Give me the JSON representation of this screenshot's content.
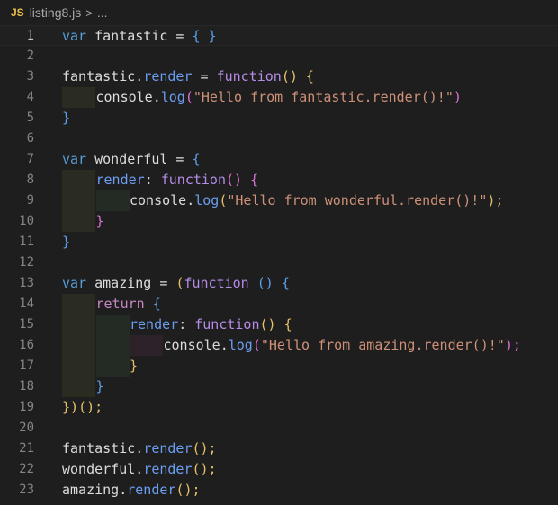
{
  "breadcrumb": {
    "badge": "JS",
    "file": "listing8.js",
    "separator": ">",
    "ellipsis": "..."
  },
  "editor": {
    "current_line": 1,
    "lines": [
      {
        "n": "1",
        "indent": 0,
        "tokens": [
          [
            "var ",
            "tok-var"
          ],
          [
            "fantastic = ",
            "tok-ident"
          ],
          [
            "{ }",
            "tok-brace"
          ]
        ]
      },
      {
        "n": "2",
        "indent": 0,
        "tokens": []
      },
      {
        "n": "3",
        "indent": 0,
        "tokens": [
          [
            "fantastic.",
            "tok-ident"
          ],
          [
            "render",
            "tok-prop"
          ],
          [
            " = ",
            "tok-ident"
          ],
          [
            "function",
            "tok-fn"
          ],
          [
            "() {",
            "tok-paren2"
          ]
        ]
      },
      {
        "n": "4",
        "indent": 1,
        "tokens": [
          [
            "console.",
            "tok-ident"
          ],
          [
            "log",
            "tok-prop"
          ],
          [
            "(",
            "tok-paren"
          ],
          [
            "\"Hello from fantastic.render()!\"",
            "tok-str"
          ],
          [
            ")",
            "tok-paren"
          ]
        ]
      },
      {
        "n": "5",
        "indent": 0,
        "tokens": [
          [
            "}",
            "tok-brace"
          ]
        ]
      },
      {
        "n": "6",
        "indent": 0,
        "tokens": []
      },
      {
        "n": "7",
        "indent": 0,
        "tokens": [
          [
            "var ",
            "tok-var"
          ],
          [
            "wonderful = ",
            "tok-ident"
          ],
          [
            "{",
            "tok-brace"
          ]
        ]
      },
      {
        "n": "8",
        "indent": 1,
        "tokens": [
          [
            "render",
            "tok-prop"
          ],
          [
            ": ",
            "tok-ident"
          ],
          [
            "function",
            "tok-fn"
          ],
          [
            "() {",
            "tok-paren"
          ]
        ]
      },
      {
        "n": "9",
        "indent": 2,
        "tokens": [
          [
            "console.",
            "tok-ident"
          ],
          [
            "log",
            "tok-prop"
          ],
          [
            "(",
            "tok-paren2"
          ],
          [
            "\"Hello from wonderful.render()!\"",
            "tok-str"
          ],
          [
            ");",
            "tok-paren2"
          ]
        ]
      },
      {
        "n": "10",
        "indent": 1,
        "tokens": [
          [
            "}",
            "tok-paren"
          ]
        ]
      },
      {
        "n": "11",
        "indent": 0,
        "tokens": [
          [
            "}",
            "tok-brace"
          ]
        ]
      },
      {
        "n": "12",
        "indent": 0,
        "tokens": []
      },
      {
        "n": "13",
        "indent": 0,
        "tokens": [
          [
            "var ",
            "tok-var"
          ],
          [
            "amazing = ",
            "tok-ident"
          ],
          [
            "(",
            "tok-paren2"
          ],
          [
            "function ",
            "tok-fn"
          ],
          [
            "() {",
            "tok-brace"
          ]
        ]
      },
      {
        "n": "14",
        "indent": 1,
        "tokens": [
          [
            "return ",
            "tok-kw"
          ],
          [
            "{",
            "tok-brace"
          ]
        ]
      },
      {
        "n": "15",
        "indent": 2,
        "tokens": [
          [
            "render",
            "tok-prop"
          ],
          [
            ": ",
            "tok-ident"
          ],
          [
            "function",
            "tok-fn"
          ],
          [
            "() {",
            "tok-paren2"
          ]
        ]
      },
      {
        "n": "16",
        "indent": 3,
        "tokens": [
          [
            "console.",
            "tok-ident"
          ],
          [
            "log",
            "tok-prop"
          ],
          [
            "(",
            "tok-paren"
          ],
          [
            "\"Hello from amazing.render()!\"",
            "tok-str"
          ],
          [
            ");",
            "tok-paren"
          ]
        ]
      },
      {
        "n": "17",
        "indent": 2,
        "tokens": [
          [
            "}",
            "tok-paren2"
          ]
        ]
      },
      {
        "n": "18",
        "indent": 1,
        "tokens": [
          [
            "}",
            "tok-brace"
          ]
        ]
      },
      {
        "n": "19",
        "indent": 0,
        "tokens": [
          [
            "})",
            "tok-paren2"
          ],
          [
            "();",
            "tok-paren2"
          ]
        ]
      },
      {
        "n": "20",
        "indent": 0,
        "tokens": []
      },
      {
        "n": "21",
        "indent": 0,
        "tokens": [
          [
            "fantastic.",
            "tok-ident"
          ],
          [
            "render",
            "tok-prop"
          ],
          [
            "();",
            "tok-paren2"
          ]
        ]
      },
      {
        "n": "22",
        "indent": 0,
        "tokens": [
          [
            "wonderful.",
            "tok-ident"
          ],
          [
            "render",
            "tok-prop"
          ],
          [
            "();",
            "tok-paren2"
          ]
        ]
      },
      {
        "n": "23",
        "indent": 0,
        "tokens": [
          [
            "amazing.",
            "tok-ident"
          ],
          [
            "render",
            "tok-prop"
          ],
          [
            "();",
            "tok-paren2"
          ]
        ]
      }
    ]
  }
}
